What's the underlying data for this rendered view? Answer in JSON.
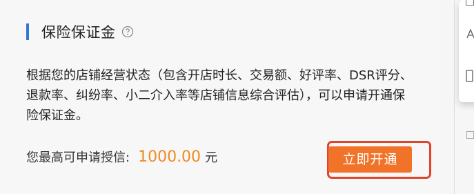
{
  "section": {
    "title": "保险保证金",
    "description": "根据您的店铺经营状态（包含开店时长、交易额、好评率、DSR评分、退款率、纠纷率、小二介入率等店铺信息综合评估），可以申请开通保险保证金。"
  },
  "credit": {
    "label": "您最高可申请授信:",
    "amount": "1000.00",
    "unit": "元"
  },
  "actions": {
    "open_button_label": "立即开通"
  },
  "colors": {
    "accent_blue": "#2f78d6",
    "button_orange": "#f17329",
    "amount_orange": "#f08a24",
    "highlight_red": "#e0452c"
  },
  "icons": {
    "help": "question-circle-icon"
  }
}
